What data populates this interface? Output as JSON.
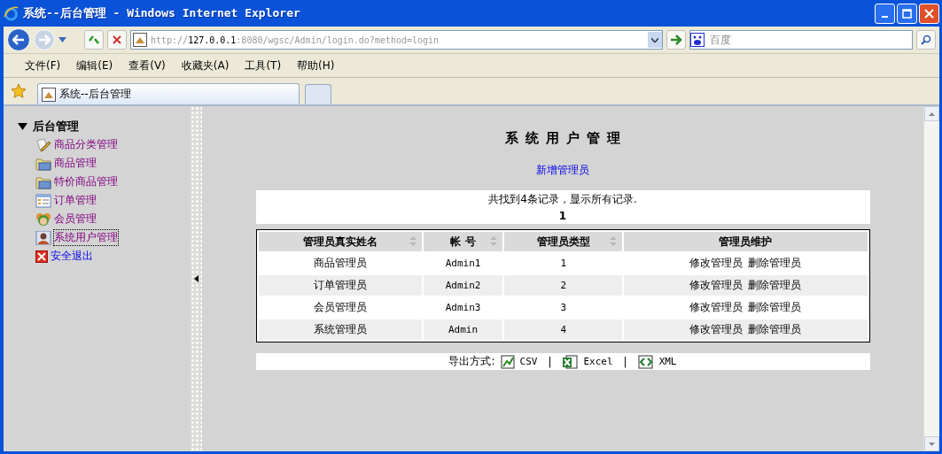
{
  "window": {
    "title": "系统--后台管理 - Windows Internet Explorer"
  },
  "address_bar": {
    "url_scheme": "http://",
    "url_host": "127.0.0.1",
    "url_rest": ":8080/wgsc/Admin/login.do?method=login"
  },
  "search": {
    "placeholder": "百度"
  },
  "menu": [
    "文件(F)",
    "编辑(E)",
    "查看(V)",
    "收藏夹(A)",
    "工具(T)",
    "帮助(H)"
  ],
  "tabs": [
    {
      "label": "系统--后台管理",
      "selected": true
    }
  ],
  "sidebar": {
    "title": "后台管理",
    "expanded": true,
    "items": [
      {
        "label": "商品分类管理",
        "kind": "edit",
        "visited": true,
        "selected": false
      },
      {
        "label": "商品管理",
        "kind": "folder",
        "visited": true,
        "selected": false
      },
      {
        "label": "特价商品管理",
        "kind": "folder",
        "visited": true,
        "selected": false
      },
      {
        "label": "订单管理",
        "kind": "list",
        "visited": true,
        "selected": false
      },
      {
        "label": "会员管理",
        "kind": "members",
        "visited": true,
        "selected": false
      },
      {
        "label": "系统用户管理",
        "kind": "user",
        "visited": true,
        "selected": true
      },
      {
        "label": "安全退出",
        "kind": "exit",
        "visited": false,
        "selected": false
      }
    ]
  },
  "main": {
    "title": "系统用户管理",
    "new_link": "新增管理员",
    "summary": "共找到4条记录，显示所有记录.",
    "page": "1",
    "table": {
      "columns": [
        {
          "label": "管理员真实姓名",
          "sortable": true
        },
        {
          "label": "帐 号",
          "sortable": true
        },
        {
          "label": "管理员类型",
          "sortable": true
        },
        {
          "label": "管理员维护",
          "sortable": false
        }
      ],
      "rows": [
        {
          "name": "商品管理员",
          "account": "Admin1",
          "type": "1",
          "actions": [
            "修改管理员",
            "删除管理员"
          ]
        },
        {
          "name": "订单管理员",
          "account": "Admin2",
          "type": "2",
          "actions": [
            "修改管理员",
            "删除管理员"
          ]
        },
        {
          "name": "会员管理员",
          "account": "Admin3",
          "type": "3",
          "actions": [
            "修改管理员",
            "删除管理员"
          ]
        },
        {
          "name": "系统管理员",
          "account": "Admin",
          "type": "4",
          "actions": [
            "修改管理员",
            "删除管理员"
          ]
        }
      ]
    },
    "export": {
      "label": "导出方式:",
      "items": [
        {
          "kind": "csv",
          "label": "CSV"
        },
        {
          "kind": "separator",
          "label": "|"
        },
        {
          "kind": "excel",
          "label": "Excel"
        },
        {
          "kind": "separator",
          "label": "|"
        },
        {
          "kind": "xml",
          "label": "XML"
        }
      ]
    }
  }
}
